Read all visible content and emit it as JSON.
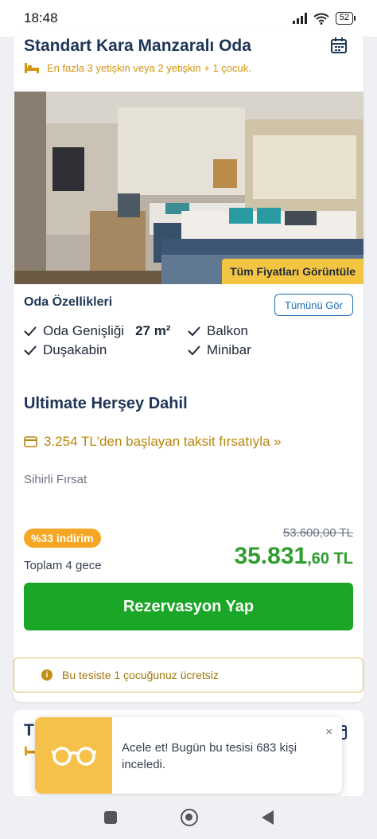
{
  "status_bar": {
    "time": "18:48",
    "battery": "52"
  },
  "room": {
    "title": "Standart Kara Manzaralı Oda",
    "capacity": "En fazla 3 yetişkin veya 2 yetişkin + 1 çocuk.",
    "photo_button": "Tüm Fiyatları Görüntüle"
  },
  "features": {
    "title": "Oda Özellikleri",
    "see_all": "Tümünü Gör",
    "items": [
      {
        "label": "Oda Genişliği",
        "value": "27 m²"
      },
      {
        "label": "Balkon"
      },
      {
        "label": "Duşakabin"
      },
      {
        "label": "Minibar"
      }
    ]
  },
  "offer": {
    "board": "Ultimate Herşey Dahil",
    "installment": "3.254 TL'den başlayan taksit fırsatıyla »",
    "deal_name": "Sihirli Fırsat",
    "discount_badge": "%33 indirim",
    "old_price": "53.600,00 TL",
    "price_integer": "35.831",
    "price_decimal": ",60 TL",
    "nights": "Toplam 4 gece",
    "book_button": "Rezervasyon Yap"
  },
  "child_note": "Bu tesiste 1 çocuğunuz ücretsiz",
  "next_card": {
    "title": "T"
  },
  "toast": {
    "message": "Acele et! Bugün bu tesisi 683 kişi inceledi.",
    "close": "×"
  },
  "colors": {
    "primary_text": "#1d3557",
    "accent_yellow": "#f4c542",
    "price_green": "#2e9e2e",
    "book_green": "#1aa727",
    "link_blue": "#1e6fb8"
  },
  "icons": [
    "wifi-icon",
    "signal-icon",
    "battery-icon",
    "calendar-icon",
    "bed-icon",
    "check-icon",
    "card-icon",
    "info-icon",
    "glasses-icon",
    "close-icon"
  ]
}
